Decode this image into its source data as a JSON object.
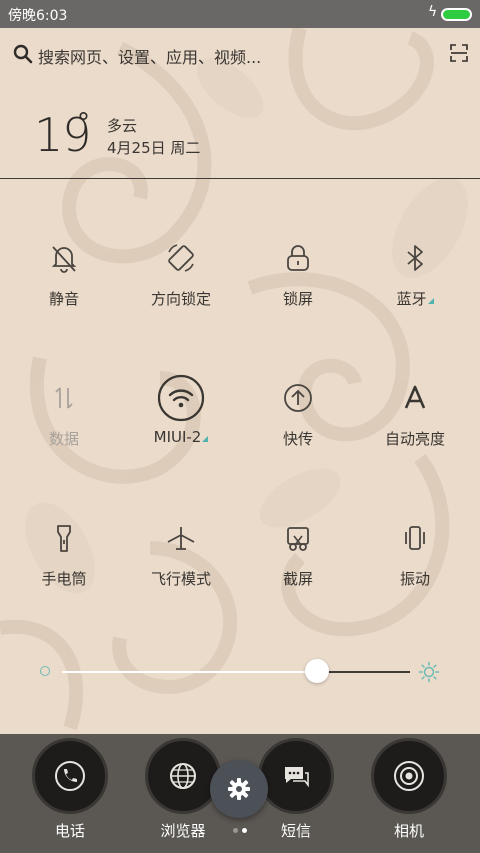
{
  "status_bar": {
    "time": "傍晚6:03",
    "battery_color": "#2ecc40"
  },
  "search": {
    "placeholder": "搜索网页、设置、应用、视频..."
  },
  "weather": {
    "temperature": "19",
    "degree": "°",
    "condition": "多云",
    "date": "4月25日 周二"
  },
  "toggles": [
    {
      "label": "静音",
      "icon": "bell-off-icon",
      "enabled": true
    },
    {
      "label": "方向锁定",
      "icon": "rotation-lock-icon",
      "enabled": true
    },
    {
      "label": "锁屏",
      "icon": "lock-icon",
      "enabled": true
    },
    {
      "label": "蓝牙",
      "icon": "bluetooth-icon",
      "enabled": true
    },
    {
      "label": "数据",
      "icon": "mobile-data-icon",
      "enabled": false
    },
    {
      "label": "MIUI-2",
      "icon": "wifi-icon",
      "enabled": true
    },
    {
      "label": "快传",
      "icon": "quick-transfer-icon",
      "enabled": true
    },
    {
      "label": "自动亮度",
      "icon": "auto-brightness-icon",
      "enabled": true
    },
    {
      "label": "手电筒",
      "icon": "flashlight-icon",
      "enabled": true
    },
    {
      "label": "飞行模式",
      "icon": "airplane-icon",
      "enabled": true
    },
    {
      "label": "截屏",
      "icon": "screenshot-icon",
      "enabled": true
    },
    {
      "label": "振动",
      "icon": "vibrate-icon",
      "enabled": true
    }
  ],
  "brightness": {
    "level_percent": 74
  },
  "dock": {
    "apps": [
      {
        "label": "电话",
        "icon": "phone-icon"
      },
      {
        "label": "浏览器",
        "icon": "globe-icon"
      },
      {
        "label": "短信",
        "icon": "message-icon"
      },
      {
        "label": "相机",
        "icon": "camera-icon"
      }
    ],
    "settings_icon": "gear-icon"
  },
  "colors": {
    "accent": "#4fb3b0",
    "panel_bg": "#eadbcb",
    "dock_bg": "#5b5753"
  }
}
